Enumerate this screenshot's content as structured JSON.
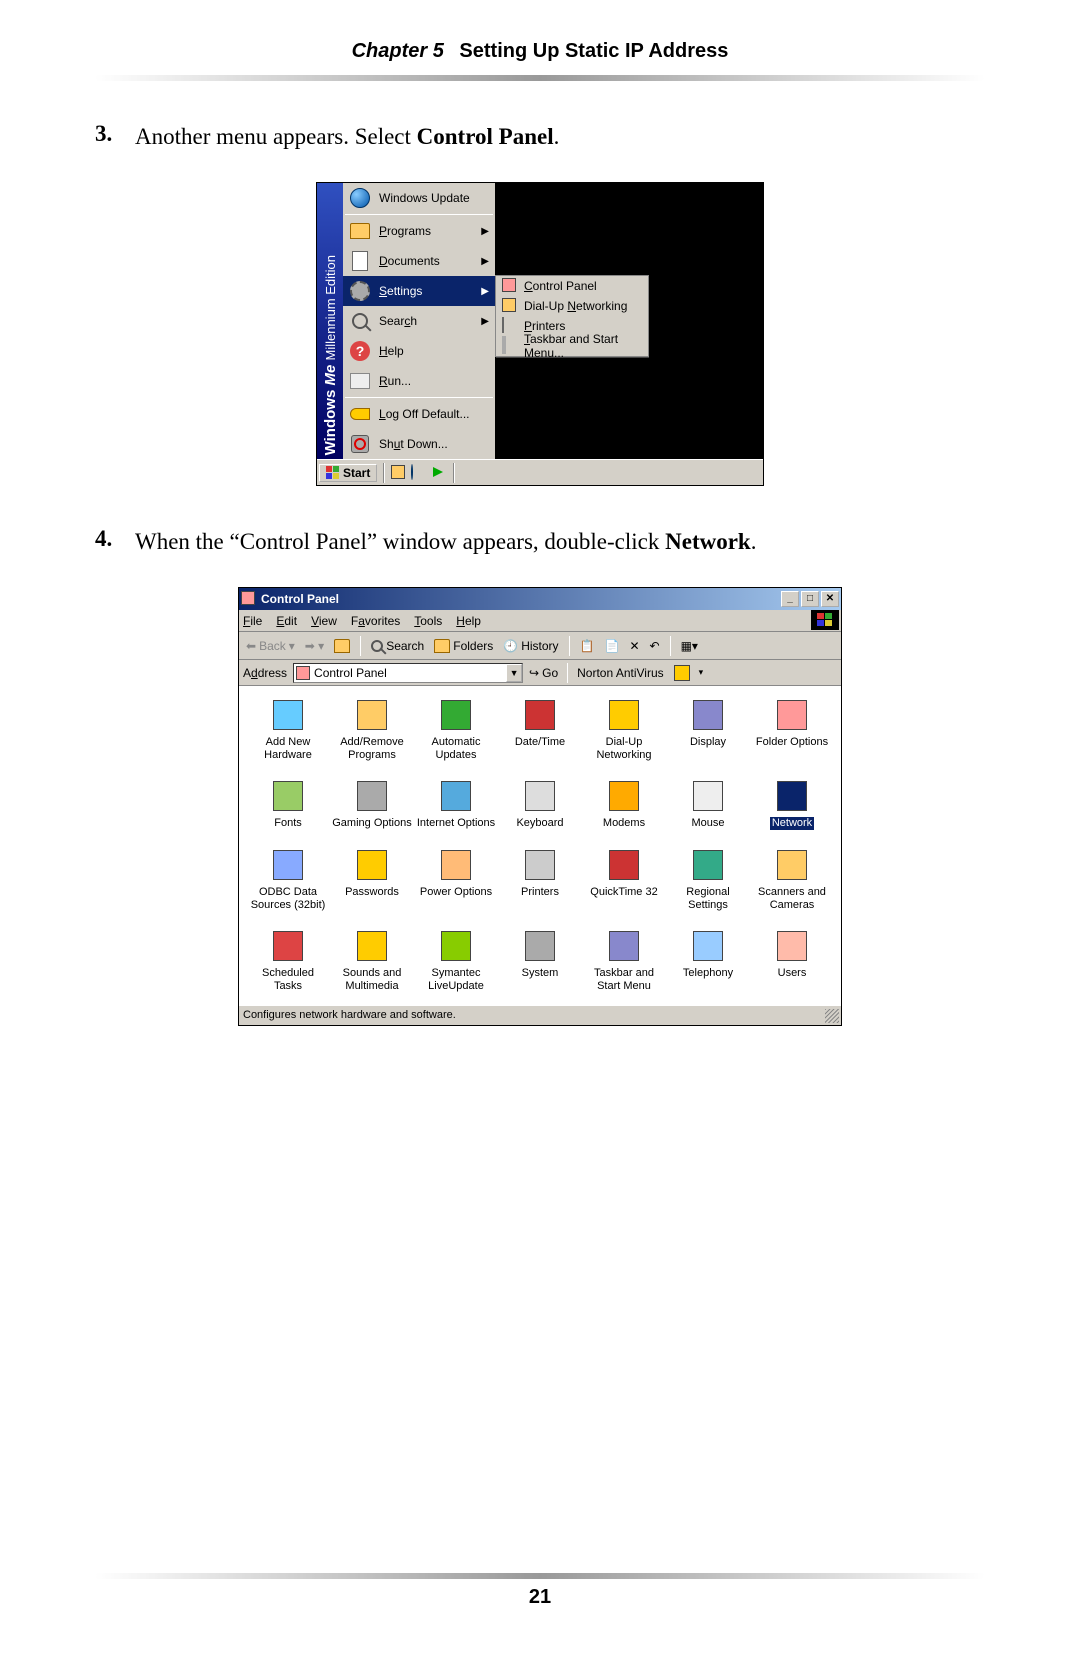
{
  "header": {
    "chapter_label": "Chapter 5",
    "chapter_title": "Setting Up Static IP Address"
  },
  "page_number": "21",
  "steps": {
    "s3": {
      "num": "3.",
      "pre": "Another menu appears. Select ",
      "bold": "Control Panel",
      "post": "."
    },
    "s4": {
      "num": "4.",
      "pre": "When the “Control Panel” window appears, double-click ",
      "bold": "Network",
      "post": "."
    }
  },
  "startmenu": {
    "sidebar_brand": "Windows",
    "sidebar_me": "Me",
    "sidebar_edition": "Millennium Edition",
    "items": {
      "update": "Windows Update",
      "programs": "Programs",
      "documents": "Documents",
      "settings": "Settings",
      "search": "Search",
      "help": "Help",
      "run": "Run...",
      "logoff": "Log Off Default...",
      "shutdown": "Shut Down..."
    },
    "submenu": {
      "control_panel": "Control Panel",
      "dialup": "Dial-Up Networking",
      "printers": "Printers",
      "taskbar": "Taskbar and Start Menu..."
    },
    "start_button": "Start"
  },
  "cp": {
    "title": "Control Panel",
    "menus": {
      "file": "File",
      "edit": "Edit",
      "view": "View",
      "favorites": "Favorites",
      "tools": "Tools",
      "help": "Help"
    },
    "toolbar": {
      "back": "Back",
      "search": "Search",
      "folders": "Folders",
      "history": "History"
    },
    "address_label": "Address",
    "address_value": "Control Panel",
    "go": "Go",
    "norton": "Norton AntiVirus",
    "status": "Configures network hardware and software.",
    "icons": [
      {
        "label": "Add New Hardware"
      },
      {
        "label": "Add/Remove Programs"
      },
      {
        "label": "Automatic Updates"
      },
      {
        "label": "Date/Time"
      },
      {
        "label": "Dial-Up Networking"
      },
      {
        "label": "Display"
      },
      {
        "label": "Folder Options"
      },
      {
        "label": "Fonts"
      },
      {
        "label": "Gaming Options"
      },
      {
        "label": "Internet Options"
      },
      {
        "label": "Keyboard"
      },
      {
        "label": "Modems"
      },
      {
        "label": "Mouse"
      },
      {
        "label": "Network",
        "selected": true
      },
      {
        "label": "ODBC Data Sources (32bit)"
      },
      {
        "label": "Passwords"
      },
      {
        "label": "Power Options"
      },
      {
        "label": "Printers"
      },
      {
        "label": "QuickTime 32"
      },
      {
        "label": "Regional Settings"
      },
      {
        "label": "Scanners and Cameras"
      },
      {
        "label": "Scheduled Tasks"
      },
      {
        "label": "Sounds and Multimedia"
      },
      {
        "label": "Symantec LiveUpdate"
      },
      {
        "label": "System"
      },
      {
        "label": "Taskbar and Start Menu"
      },
      {
        "label": "Telephony"
      },
      {
        "label": "Users"
      }
    ]
  }
}
